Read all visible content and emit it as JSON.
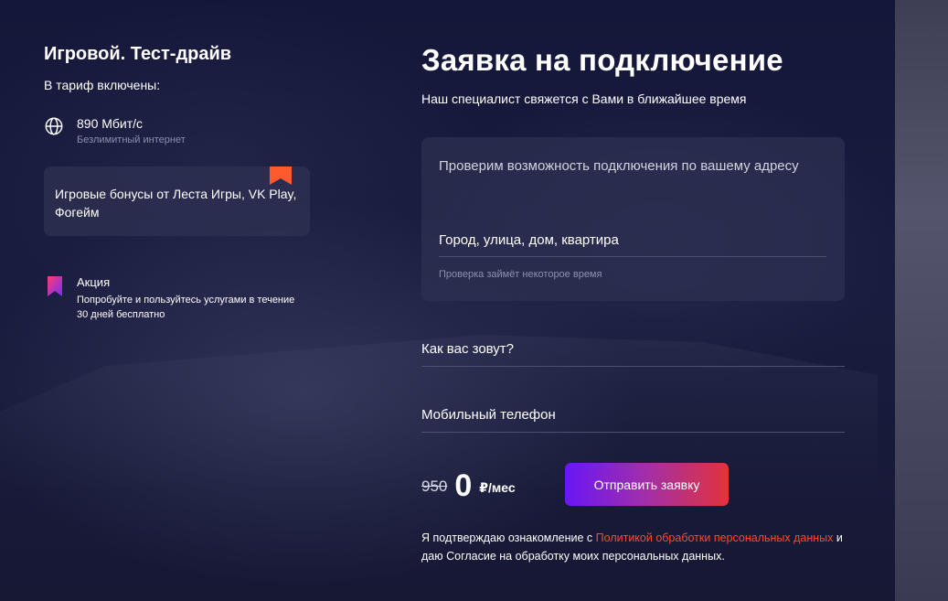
{
  "colors": {
    "background": "#141633",
    "card": "#2e3152",
    "accent_orange": "#ff5a2c",
    "link": "#ff4a2c",
    "button_gradient_start": "#6a16f6",
    "button_gradient_end": "#e2333a",
    "promo_gradient_start": "#ff3b6b",
    "promo_gradient_end": "#7a2cff"
  },
  "plan": {
    "title": "Игровой. Тест-драйв",
    "included_label": "В тариф включены:",
    "speed": {
      "icon": "globe-icon",
      "value": "890 Мбит/с",
      "description": "Безлимитный интернет"
    },
    "bonus": {
      "icon": "bookmark-icon",
      "text": "Игровые бонусы от Леста Игры, VK Play, Фогейм"
    },
    "promo": {
      "icon": "promo-bookmark-icon",
      "title": "Акция",
      "description": "Попробуйте и пользуйтесь услугами в течение 30 дней бесплатно"
    }
  },
  "form": {
    "title": "Заявка на подключение",
    "subtitle": "Наш специалист свяжется с Вами в ближайшее время",
    "address": {
      "heading": "Проверим возможность подключения по вашему адресу",
      "placeholder": "Город, улица, дом, квартира",
      "hint": "Проверка займёт некоторое время"
    },
    "name_placeholder": "Как вас зовут?",
    "phone_placeholder": "Мобильный телефон",
    "price": {
      "old": "950",
      "new": "0",
      "unit": "₽/мес"
    },
    "submit_label": "Отправить заявку",
    "consent": {
      "before": "Я подтверждаю ознакомление с ",
      "link": "Политикой обработки персональных данных",
      "after": " и даю Согласие на обработку моих персональных данных."
    }
  }
}
